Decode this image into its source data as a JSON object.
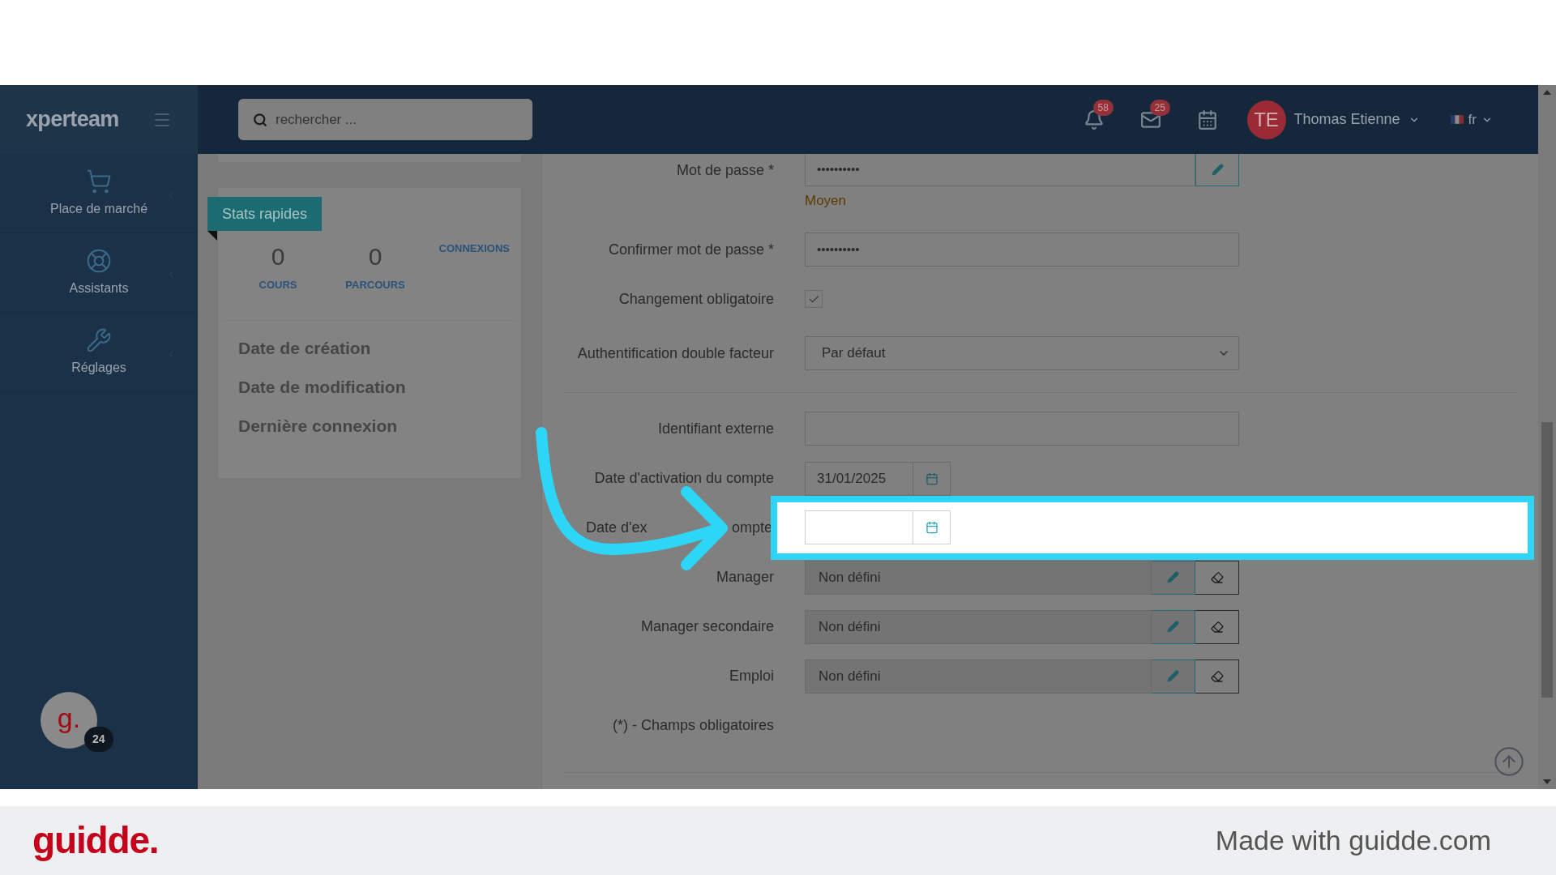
{
  "top_bar": {
    "logo": "xperteam",
    "search": {
      "placeholder": "rechercher ..."
    },
    "notifications": {
      "badge": "58"
    },
    "messages": {
      "badge": "25"
    },
    "user": {
      "initials": "TE",
      "name": "Thomas Etienne"
    },
    "language": "fr"
  },
  "sidebar": {
    "items": [
      {
        "label": "Place de marché",
        "kind": "cart"
      },
      {
        "label": "Assistants",
        "kind": "help"
      },
      {
        "label": "Réglages",
        "kind": "settings"
      }
    ]
  },
  "help_widget": {
    "letter": "g.",
    "badge": "24"
  },
  "stats_card": {
    "title": "Stats rapides",
    "stats": [
      {
        "value": "0",
        "label": "COURS"
      },
      {
        "value": "0",
        "label": "PARCOURS"
      }
    ],
    "connexions": "CONNEXIONS",
    "dates": [
      "Date de création",
      "Date de modification",
      "Dernière connexion"
    ]
  },
  "form": {
    "rows": [
      {
        "kind": "password_edit",
        "label": "Mot de passe *",
        "value": "••••••••••",
        "strength": "Moyen"
      },
      {
        "kind": "password",
        "label": "Confirmer mot de passe *",
        "value": "••••••••••"
      },
      {
        "kind": "checkbox",
        "label": "Changement obligatoire",
        "checked": true
      },
      {
        "kind": "select",
        "label": "Authentification double facteur",
        "value": "Par défaut"
      },
      {
        "kind": "text",
        "label": "Identifiant externe",
        "divider_before": true
      },
      {
        "kind": "date",
        "label": "Date d'activation du compte",
        "value": "31/01/2025",
        "highlighted": false
      },
      {
        "kind": "date",
        "label_parts": [
          "Date d'ex",
          "ompte"
        ],
        "highlighted": true
      },
      {
        "kind": "picker",
        "label": "Manager",
        "value": "Non défini"
      },
      {
        "kind": "picker",
        "label": "Manager secondaire",
        "value": "Non défini"
      },
      {
        "kind": "picker",
        "label": "Emploi",
        "value": "Non défini"
      }
    ],
    "footnote": "(*) - Champs obligatoires"
  },
  "footer": {
    "brand": "guidde.",
    "text": "Made with guidde.com"
  }
}
